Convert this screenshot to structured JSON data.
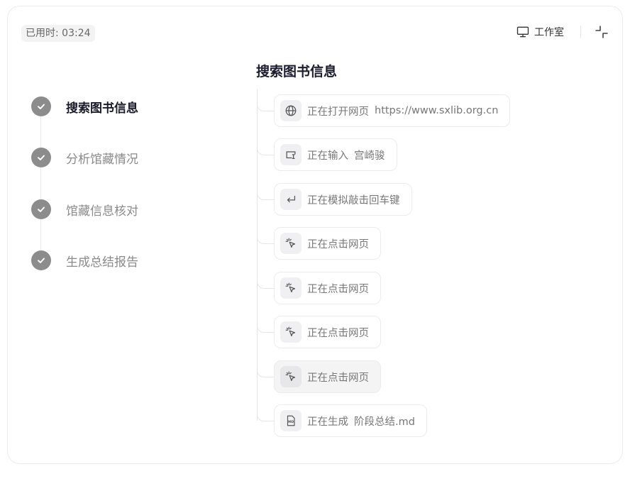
{
  "header": {
    "elapsed": "已用时: 03:24",
    "studio_label": "工作室"
  },
  "steps": [
    {
      "label": "搜索图书信息",
      "state": "active"
    },
    {
      "label": "分析馆藏情况",
      "state": "done"
    },
    {
      "label": "馆藏信息核对",
      "state": "done"
    },
    {
      "label": "生成总结报告",
      "state": "done"
    }
  ],
  "section": {
    "title": "搜索图书信息"
  },
  "actions": [
    {
      "icon": "globe-icon",
      "text": "正在打开网页",
      "detail": "https://www.sxlib.org.cn"
    },
    {
      "icon": "text-input-icon",
      "text": "正在输入",
      "detail": "宫崎骏"
    },
    {
      "icon": "enter-key-icon",
      "text": "正在模拟敲击回车键",
      "detail": ""
    },
    {
      "icon": "cursor-click-icon",
      "text": "正在点击网页",
      "detail": ""
    },
    {
      "icon": "cursor-click-icon",
      "text": "正在点击网页",
      "detail": ""
    },
    {
      "icon": "cursor-click-icon",
      "text": "正在点击网页",
      "detail": ""
    },
    {
      "icon": "cursor-click-icon",
      "text": "正在点击网页",
      "detail": ""
    },
    {
      "icon": "markdown-file-icon",
      "text": "正在生成",
      "detail": "阶段总结.md"
    }
  ],
  "colors": {
    "step_done": "#8c8c8c",
    "title": "#1b1b2e",
    "muted_text": "#777777"
  }
}
